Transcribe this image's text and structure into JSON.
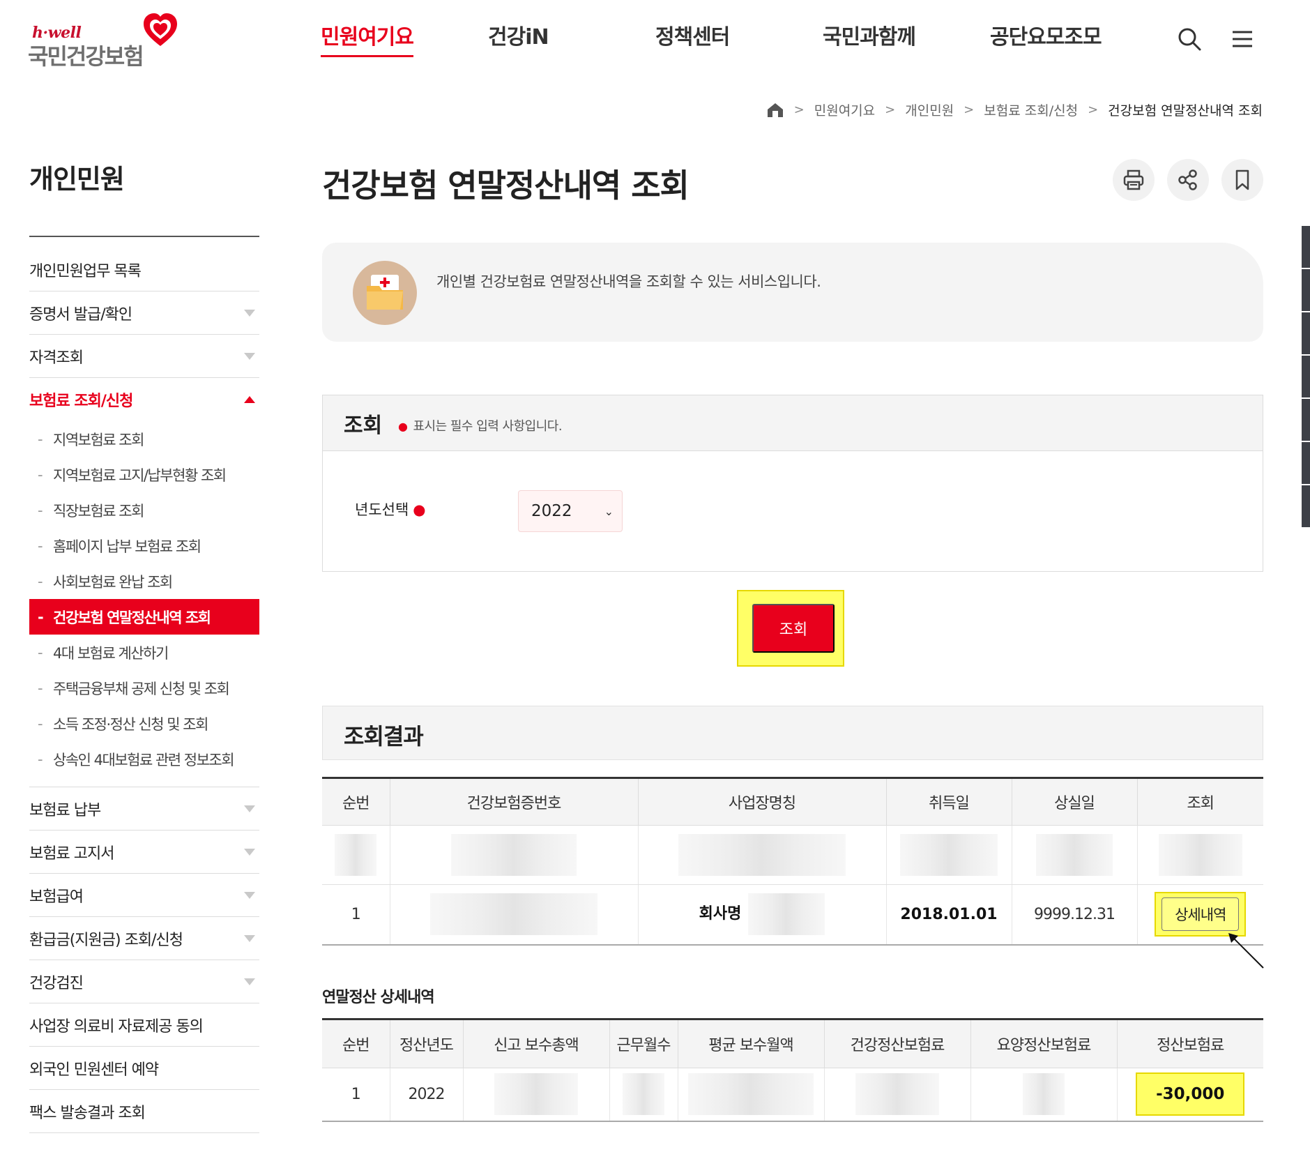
{
  "logo": {
    "tagline": "h·well",
    "name": "국민건강보험"
  },
  "gnb": {
    "items": [
      {
        "label": "민원여기요",
        "active": true
      },
      {
        "label": "건강iN",
        "active": false
      },
      {
        "label": "정책센터",
        "active": false
      },
      {
        "label": "국민과함께",
        "active": false
      },
      {
        "label": "공단요모조모",
        "active": false
      }
    ]
  },
  "breadcrumb": {
    "items": [
      "민원여기요",
      "개인민원",
      "보험료 조회/신청",
      "건강보험 연말정산내역 조회"
    ]
  },
  "sidebar": {
    "title": "개인민원",
    "items": [
      {
        "label": "개인민원업무 목록"
      },
      {
        "label": "증명서 발급/확인"
      },
      {
        "label": "자격조회"
      },
      {
        "label": "보험료 조회/신청"
      },
      {
        "label": "보험료 납부"
      },
      {
        "label": "보험료 고지서"
      },
      {
        "label": "보험급여"
      },
      {
        "label": "환급금(지원금) 조회/신청"
      },
      {
        "label": "건강검진"
      },
      {
        "label": "사업장 의료비 자료제공 동의"
      },
      {
        "label": "외국인 민원센터 예약"
      },
      {
        "label": "팩스 발송결과 조회"
      }
    ],
    "sub_items": [
      "지역보험료 조회",
      "지역보험료 고지/납부현황 조회",
      "직장보험료 조회",
      "홈페이지 납부 보험료 조회",
      "사회보험료 완납 조회",
      "건강보험 연말정산내역 조회",
      "4대 보험료 계산하기",
      "주택금융부채 공제 신청 및 조회",
      "소득 조정·정산 신청 및 조회",
      "상속인 4대보험료 관련 정보조회"
    ]
  },
  "page": {
    "title": "건강보험 연말정산내역 조회",
    "intro": "개인별 건강보험료 연말정산내역을 조회할 수 있는 서비스입니다."
  },
  "form": {
    "title": "조회",
    "note": "표시는 필수 입력 사항입니다.",
    "year_label": "년도선택",
    "year_value": "2022",
    "submit_label": "조회"
  },
  "result": {
    "title": "조회결과",
    "columns": [
      "순번",
      "건강보험증번호",
      "사업장명칭",
      "취득일",
      "상실일",
      "조회"
    ],
    "row": {
      "no": "1",
      "company": "회사명",
      "acquired": "2018.01.01",
      "lost": "9999.12.31",
      "detail_label": "상세내역"
    }
  },
  "detail": {
    "title": "연말정산 상세내역",
    "columns": [
      "순번",
      "정산년도",
      "신고 보수총액",
      "근무월수",
      "평균 보수월액",
      "건강정산보험료",
      "요양정산보험료",
      "정산보험료"
    ],
    "row": {
      "no": "1",
      "year": "2022",
      "settlement": "-30,000"
    }
  },
  "colors": {
    "accent": "#e8001c",
    "highlight": "#ffff66"
  }
}
